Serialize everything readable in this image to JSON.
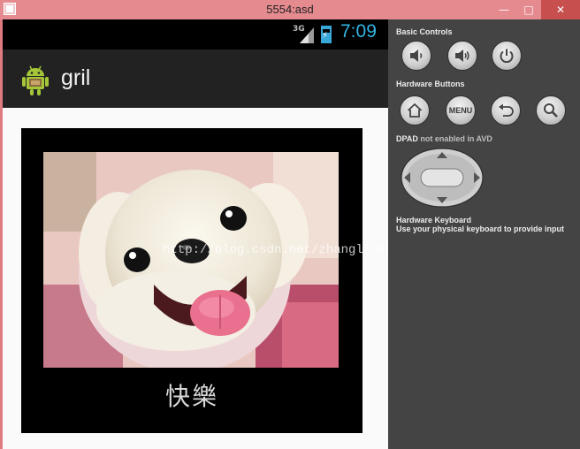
{
  "window": {
    "title": "5554:asd",
    "minimize_glyph": "—",
    "maximize_glyph": "□",
    "close_glyph": "✕"
  },
  "status_bar": {
    "network": "3G",
    "time": "7:09"
  },
  "action_bar": {
    "title": "gril"
  },
  "content": {
    "caption": "快樂",
    "caption_sub": "​",
    "watermark": "http://blog.csdn.net/zhanglinzh"
  },
  "controls": {
    "basic_label": "Basic Controls",
    "hardware_label": "Hardware Buttons",
    "menu_label": "MENU",
    "dpad_label_main": "DPAD",
    "dpad_label_note": "not enabled in AVD",
    "keyboard_label": "Hardware Keyboard",
    "keyboard_sub": "Use your physical keyboard to provide input"
  },
  "colors": {
    "window_frame": "#e58a8f",
    "close_button": "#c7504f",
    "accent_blue": "#33b5e5",
    "action_bar": "#222222",
    "panel": "#444444"
  }
}
